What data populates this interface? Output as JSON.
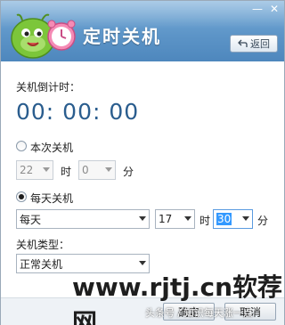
{
  "window": {
    "title": "定时关机",
    "back_label": "返回",
    "min_glyph": "—",
    "close_glyph": "✕"
  },
  "countdown": {
    "label": "关机倒计时：",
    "time": "00: 00: 00"
  },
  "once": {
    "label": "本次关机",
    "checked": false,
    "hour": "22",
    "hour_unit": "时",
    "minute": "0",
    "minute_unit": "分"
  },
  "daily": {
    "label": "每天关机",
    "checked": true,
    "frequency": "每天",
    "hour": "17",
    "hour_unit": "时",
    "minute": "30",
    "minute_unit": "分"
  },
  "shutdown_type": {
    "label": "关机类型：",
    "value": "正常关机"
  },
  "buttons": {
    "ok": "确定",
    "cancel": "取消"
  },
  "overlay": {
    "watermark": "www.rjtj.cn软荐网",
    "credit": "头条号 / 知识每天涨一点"
  }
}
